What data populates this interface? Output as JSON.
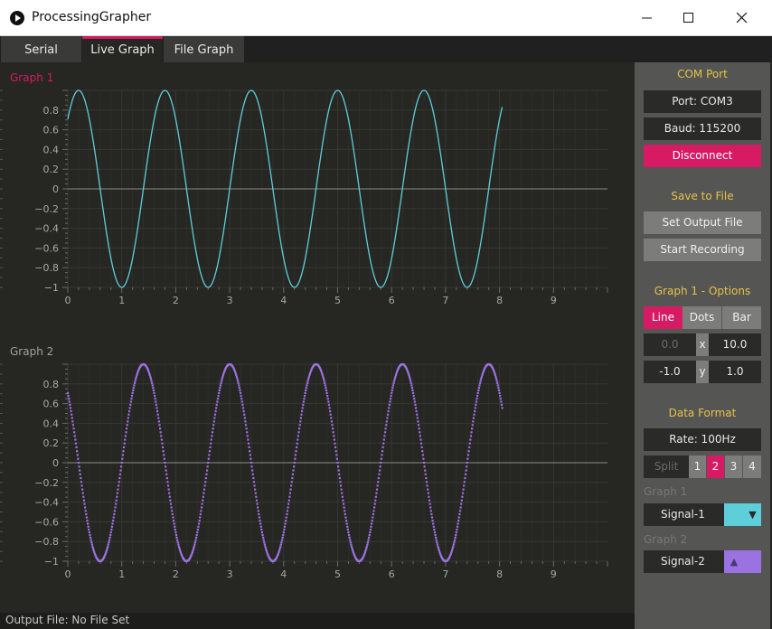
{
  "window": {
    "title": "ProcessingGrapher"
  },
  "tabs": [
    {
      "label": "Serial",
      "active": false
    },
    {
      "label": "Live Graph",
      "active": true
    },
    {
      "label": "File Graph",
      "active": false
    }
  ],
  "graphs": {
    "graph1": {
      "label": "Graph 1",
      "label_color": "#d61a63",
      "style": "line",
      "series_color": "#5ecfda",
      "x_ticks": [
        "0",
        "1",
        "2",
        "3",
        "4",
        "5",
        "6",
        "7",
        "8",
        "9"
      ],
      "y_ticks": [
        "0.8",
        "0.6",
        "0.4",
        "0.2",
        "0",
        "−0.2",
        "−0.4",
        "−0.6",
        "−0.8",
        "−1"
      ]
    },
    "graph2": {
      "label": "Graph 2",
      "label_color": "#a0a09e",
      "style": "dots",
      "series_color": "#9b73e0",
      "x_ticks": [
        "0",
        "1",
        "2",
        "3",
        "4",
        "5",
        "6",
        "7",
        "8",
        "9"
      ],
      "y_ticks": [
        "0.8",
        "0.6",
        "0.4",
        "0.2",
        "0",
        "−0.2",
        "−0.4",
        "−0.6",
        "−0.8",
        "−1"
      ]
    }
  },
  "chart_data": [
    {
      "type": "line",
      "title": "Graph 1",
      "xlim": [
        0,
        10
      ],
      "ylim": [
        -1,
        1
      ],
      "grid": true,
      "series": [
        {
          "function": "cos",
          "period": 1.6,
          "phase": 0.2,
          "x_start": 0,
          "x_end": 8.05
        }
      ]
    },
    {
      "type": "scatter",
      "title": "Graph 2",
      "xlim": [
        0,
        10
      ],
      "ylim": [
        -1,
        1
      ],
      "grid": true,
      "series": [
        {
          "function": "cos",
          "period": 1.6,
          "phase": 1.4,
          "x_start": 0,
          "x_end": 8.05
        }
      ]
    }
  ],
  "status": {
    "output_file": "Output File: No File Set"
  },
  "sidebar": {
    "com_port": {
      "title": "COM Port",
      "port": "Port: COM3",
      "baud": "Baud: 115200",
      "disconnect": "Disconnect"
    },
    "save": {
      "title": "Save to File",
      "set_output": "Set Output File",
      "start_recording": "Start Recording"
    },
    "options": {
      "title": "Graph 1 - Options",
      "line": "Line",
      "dots": "Dots",
      "bar": "Bar",
      "x_min": "0.0",
      "x_label": "x",
      "x_max": "10.0",
      "y_min": "-1.0",
      "y_label": "y",
      "y_max": "1.0"
    },
    "data_format": {
      "title": "Data Format",
      "rate": "Rate: 100Hz",
      "split": "Split",
      "split_opts": [
        "1",
        "2",
        "3",
        "4"
      ],
      "graph1_label": "Graph 1",
      "graph1_signal": "Signal-1",
      "graph1_color": "#5ecfda",
      "graph2_label": "Graph 2",
      "graph2_signal": "Signal-2",
      "graph2_color": "#9b73e0"
    }
  },
  "colors": {
    "accent": "#d61a63",
    "heading": "#e6c24a"
  }
}
